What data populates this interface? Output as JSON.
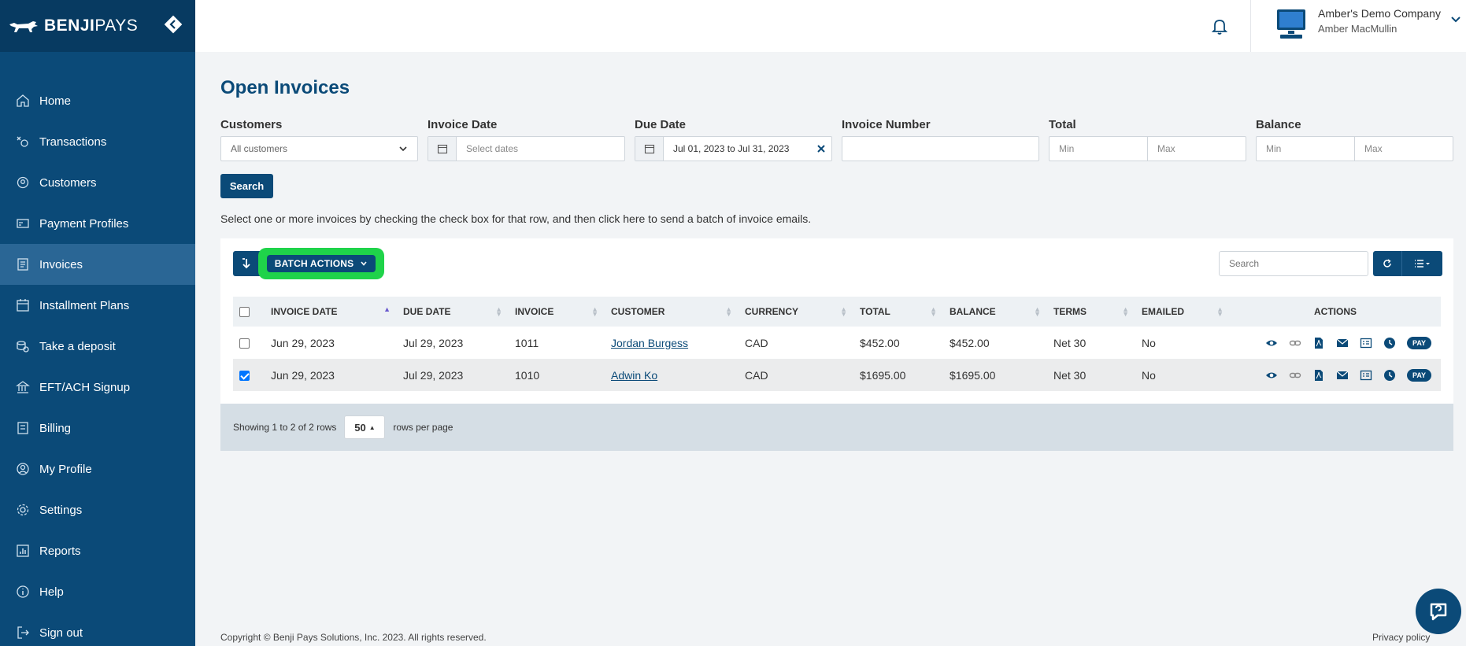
{
  "brand": {
    "bold": "BENJI",
    "light": "PAYS"
  },
  "sidebar": {
    "items": [
      {
        "label": "Home",
        "icon": "home-icon"
      },
      {
        "label": "Transactions",
        "icon": "transactions-icon"
      },
      {
        "label": "Customers",
        "icon": "customers-icon"
      },
      {
        "label": "Payment Profiles",
        "icon": "payment-profiles-icon"
      },
      {
        "label": "Invoices",
        "icon": "invoices-icon",
        "active": true
      },
      {
        "label": "Installment Plans",
        "icon": "calendar-icon"
      },
      {
        "label": "Take a deposit",
        "icon": "deposit-icon"
      },
      {
        "label": "EFT/ACH Signup",
        "icon": "bank-icon"
      },
      {
        "label": "Billing",
        "icon": "billing-icon"
      },
      {
        "label": "My Profile",
        "icon": "profile-icon"
      },
      {
        "label": "Settings",
        "icon": "gear-icon"
      },
      {
        "label": "Reports",
        "icon": "reports-icon"
      },
      {
        "label": "Help",
        "icon": "help-icon"
      },
      {
        "label": "Sign out",
        "icon": "sign-out-icon"
      }
    ]
  },
  "header": {
    "company": "Amber's Demo Company",
    "user": "Amber MacMullin"
  },
  "page": {
    "title": "Open Invoices"
  },
  "filters": {
    "customers": {
      "label": "Customers",
      "value": "All customers"
    },
    "invoice_date": {
      "label": "Invoice Date",
      "placeholder": "Select dates"
    },
    "due_date": {
      "label": "Due Date",
      "value": "Jul 01, 2023 to Jul 31, 2023"
    },
    "invoice_number": {
      "label": "Invoice Number",
      "value": ""
    },
    "total": {
      "label": "Total",
      "min": "Min",
      "max": "Max"
    },
    "balance": {
      "label": "Balance",
      "min": "Min",
      "max": "Max"
    },
    "search_label": "Search"
  },
  "hint": "Select one or more invoices by checking the check box for that row, and then click here to send a batch of invoice emails.",
  "toolbar": {
    "batch_label": "BATCH ACTIONS",
    "search_placeholder": "Search"
  },
  "table": {
    "headers": [
      "INVOICE DATE",
      "DUE DATE",
      "INVOICE",
      "CUSTOMER",
      "CURRENCY",
      "TOTAL",
      "BALANCE",
      "TERMS",
      "EMAILED",
      "ACTIONS"
    ],
    "rows": [
      {
        "checked": false,
        "invoice_date": "Jun 29, 2023",
        "due_date": "Jul 29, 2023",
        "invoice": "1011",
        "customer": "Jordan Burgess",
        "currency": "CAD",
        "total": "$452.00",
        "balance": "$452.00",
        "terms": "Net 30",
        "emailed": "No"
      },
      {
        "checked": true,
        "invoice_date": "Jun 29, 2023",
        "due_date": "Jul 29, 2023",
        "invoice": "1010",
        "customer": "Adwin Ko",
        "currency": "CAD",
        "total": "$1695.00",
        "balance": "$1695.00",
        "terms": "Net 30",
        "emailed": "No"
      }
    ],
    "pay_label": "PAY"
  },
  "pagination": {
    "showing": "Showing 1 to 2 of 2 rows",
    "page_size": "50",
    "suffix": "rows per page"
  },
  "footer": {
    "copyright": "Copyright © Benji Pays Solutions, Inc. 2023. All rights reserved.",
    "privacy": "Privacy policy"
  },
  "colors": {
    "primary": "#0b4a78",
    "highlight": "#1fd34a",
    "sidebar_active": "#2a6695"
  }
}
